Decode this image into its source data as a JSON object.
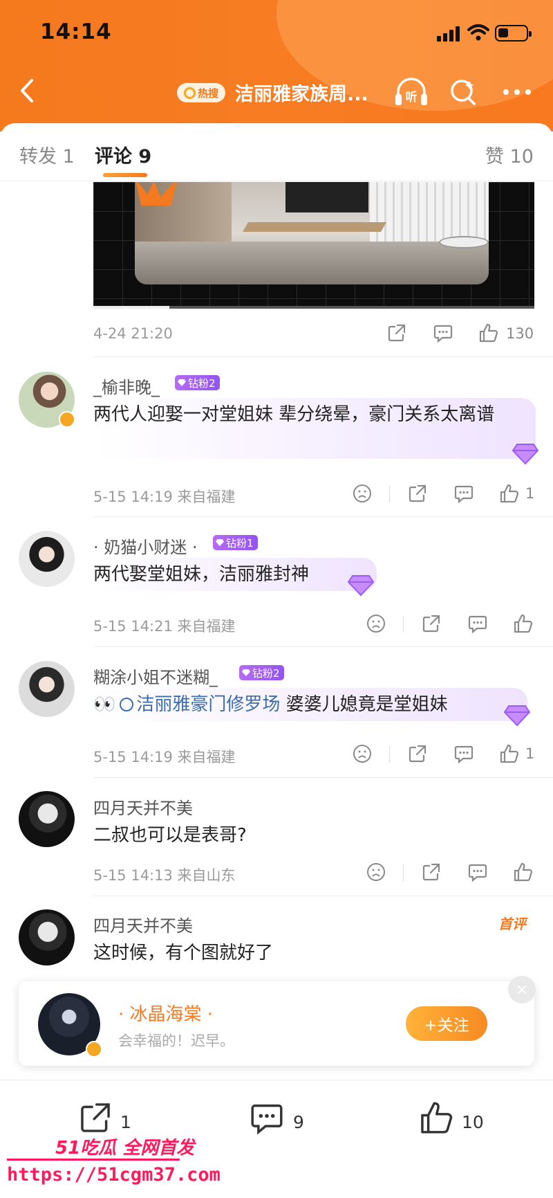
{
  "status_bar": {
    "time": "14:14"
  },
  "nav": {
    "hot_badge": "热搜",
    "title": "洁丽雅家族周...",
    "listen_label": "听"
  },
  "tabs": [
    {
      "label": "转发 1"
    },
    {
      "label": "评论 9"
    },
    {
      "label": "赞 10"
    }
  ],
  "post": {
    "date": "4-24 21:20",
    "likes": "130"
  },
  "comments": [
    {
      "name": "_榆非晚_",
      "badge": "钻粉2",
      "text": "两代人迎娶一对堂姐妹 辈分绕晕，豪门关系太离谱",
      "meta": "5-15 14:19  来自福建",
      "likes": "1"
    },
    {
      "name": "· 奶猫小财迷 ·",
      "badge": "钻粉1",
      "text": "两代娶堂姐妹，洁丽雅封神",
      "meta": "5-15 14:21  来自福建",
      "likes": ""
    },
    {
      "name": "糊涂小姐不迷糊_",
      "badge": "钻粉2",
      "text_prefix": "👀",
      "topic": "洁丽雅豪门修罗场",
      "text": " 婆婆儿媳竟是堂姐妹",
      "meta": "5-15 14:19  来自福建",
      "likes": "1"
    },
    {
      "name": "四月天并不美",
      "text": "二叔也可以是表哥?",
      "meta": "5-15 14:13  来自山东",
      "likes": ""
    },
    {
      "name": "四月天并不美",
      "text": "这时候，有个图就好了",
      "first_badge": "首评"
    }
  ],
  "follow_card": {
    "name": "· 冰晶海棠 ·",
    "subtitle": "会幸福的！迟早。",
    "button": "+关注",
    "close": "×"
  },
  "bottom_bar": {
    "repost_count": "1",
    "comment_count": "9",
    "like_count": "10"
  },
  "watermark": {
    "brand": "51吃瓜 全网首发",
    "url": "https://51cgm37.com"
  },
  "colors": {
    "accent": "#f5791f",
    "header": "#f77c22",
    "diamond_badge": "#9b5cf5",
    "topic_link": "#3b6ea8",
    "watermark": "#ff1a5e"
  },
  "icons": [
    "back-icon",
    "search-icon",
    "headphones-icon",
    "more-icon",
    "share-icon",
    "comment-icon",
    "thumbs-up-icon",
    "sad-face-icon",
    "diamond-icon",
    "close-icon"
  ]
}
